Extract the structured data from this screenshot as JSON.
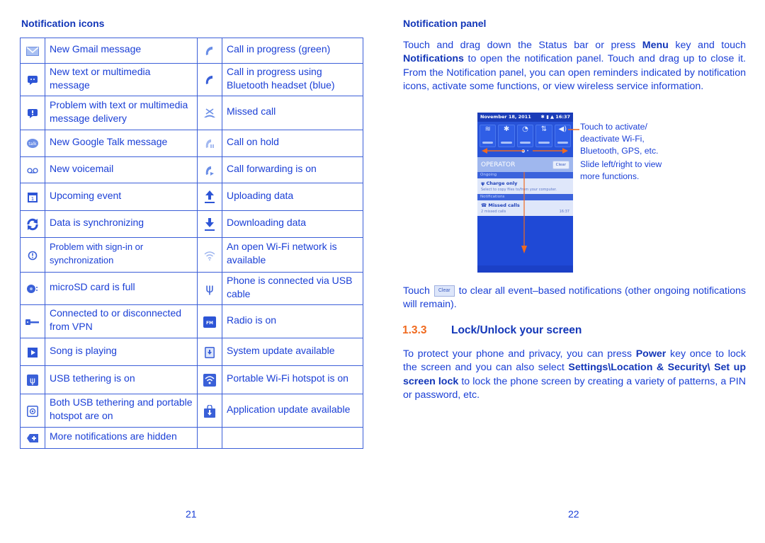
{
  "left_page": {
    "section_title": "Notification icons",
    "rows": [
      {
        "left": {
          "icon": "gmail-icon",
          "text": "New Gmail message"
        },
        "right": {
          "icon": "call-green-icon",
          "text": "Call in progress (green)"
        }
      },
      {
        "left": {
          "icon": "sms-icon",
          "text": "New text or multimedia message"
        },
        "right": {
          "icon": "call-bluetooth-icon",
          "text": "Call in progress using Bluetooth headset (blue)"
        }
      },
      {
        "left": {
          "icon": "sms-error-icon",
          "text": "Problem with text or multimedia message delivery"
        },
        "right": {
          "icon": "missed-call-icon",
          "text": "Missed call"
        }
      },
      {
        "left": {
          "icon": "google-talk-icon",
          "text": "New Google Talk message"
        },
        "right": {
          "icon": "call-hold-icon",
          "text": "Call on hold"
        }
      },
      {
        "left": {
          "icon": "voicemail-icon",
          "text": "New voicemail"
        },
        "right": {
          "icon": "call-forward-icon",
          "text": "Call forwarding is on"
        }
      },
      {
        "left": {
          "icon": "calendar-icon",
          "text": "Upcoming event"
        },
        "right": {
          "icon": "upload-icon",
          "text": "Uploading data"
        }
      },
      {
        "left": {
          "icon": "sync-icon",
          "text": "Data is synchronizing"
        },
        "right": {
          "icon": "download-icon",
          "text": "Downloading data"
        }
      },
      {
        "left": {
          "icon": "sync-error-icon",
          "text": "Problem with sign-in or synchronization"
        },
        "right": {
          "icon": "wifi-open-icon",
          "text": "An open Wi-Fi network is available"
        }
      },
      {
        "left": {
          "icon": "sd-card-full-icon",
          "text": "microSD card is full"
        },
        "right": {
          "icon": "usb-icon",
          "text": "Phone is connected via USB cable"
        }
      },
      {
        "left": {
          "icon": "vpn-key-icon",
          "text": "Connected to or disconnected from VPN"
        },
        "right": {
          "icon": "fm-radio-icon",
          "text": "Radio is on",
          "badge": "FM"
        }
      },
      {
        "left": {
          "icon": "play-icon",
          "text": "Song is playing"
        },
        "right": {
          "icon": "system-update-icon",
          "text": "System update available"
        }
      },
      {
        "left": {
          "icon": "usb-tether-icon",
          "text": "USB tethering is on"
        },
        "right": {
          "icon": "hotspot-icon",
          "text": "Portable Wi-Fi hotspot is on"
        }
      },
      {
        "left": {
          "icon": "tether-hotspot-icon",
          "text": "Both USB tethering and portable hotspot are on"
        },
        "right": {
          "icon": "app-update-icon",
          "text": "Application update available"
        }
      },
      {
        "left": {
          "icon": "more-notifications-icon",
          "text": "More notifications are hidden"
        },
        "right": {
          "icon": "",
          "text": ""
        }
      }
    ],
    "page_number": "21"
  },
  "right_page": {
    "section_title": "Notification panel",
    "intro": {
      "p1": "Touch and drag down the Status bar or press ",
      "b1": "Menu",
      "p2": " key and touch ",
      "b2": "Notifications",
      "p3": " to open the notification panel. Touch and drag up to close it. From the Notification panel, you can open reminders indicated by notification icons, activate some functions, or view wireless service information."
    },
    "phone": {
      "date": "November 18, 2011",
      "time": "16:37",
      "operator": "OPERATOR",
      "clear_label": "Clear",
      "ongoing_label": "Ongoing",
      "ongoing_title": "Charge only",
      "ongoing_sub": "Select to copy files to/from your computer.",
      "notifications_label": "Notifications",
      "notif_title": "Missed calls",
      "notif_sub": "2 missed calls",
      "notif_time": "16:37",
      "toggles": [
        "wifi",
        "bluetooth",
        "gps",
        "data",
        "sound"
      ]
    },
    "callout1": "Touch to activate/ deactivate Wi-Fi, Bluetooth, GPS, etc.",
    "callout1_lines": [
      "Touch to activate/",
      "deactivate Wi-Fi,",
      "Bluetooth, GPS, etc."
    ],
    "callout2_lines": [
      "Slide left/right to view",
      "more functions."
    ],
    "clear_para": {
      "pre": "Touch",
      "button": "Clear",
      "post": "to clear all event–based notifications (other ongoing notifications will remain)."
    },
    "heading": {
      "number": "1.3.3",
      "title": "Lock/Unlock your screen"
    },
    "lock_para": {
      "p1": "To protect your phone and privacy, you can press ",
      "b1": "Power",
      "p2": " key once to lock the screen and you can also select ",
      "b2": "Settings\\Location & Security\\ Set up screen lock",
      "p3": " to lock the phone screen by creating a variety of patterns, a PIN or password, etc."
    },
    "page_number": "22"
  },
  "colors": {
    "text": "#1a3fd6",
    "heading": "#1236b8",
    "accent": "#f06a1f",
    "border": "#3c5fd8"
  }
}
